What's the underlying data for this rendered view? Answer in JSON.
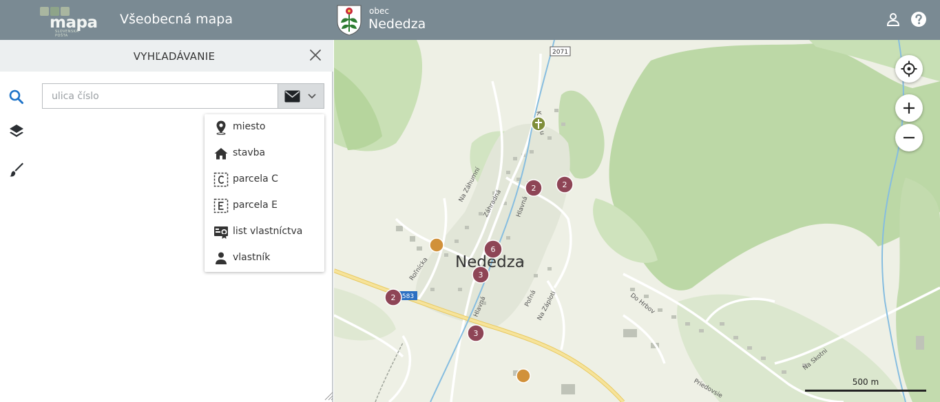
{
  "header": {
    "logo_text": "mapa",
    "logo_subtext": "SLOVENSKÁ POŠTA",
    "app_title": "Všeobecná mapa",
    "municipality_label": "obec",
    "municipality_name": "Nededza",
    "icons": [
      "user-icon",
      "help-icon"
    ]
  },
  "sidebar": {
    "tools": [
      {
        "icon": "search-icon",
        "active": true
      },
      {
        "icon": "layers-icon",
        "active": false
      },
      {
        "icon": "brush-icon",
        "active": false
      }
    ]
  },
  "panel": {
    "title": "VYHĽADÁVANIE",
    "search": {
      "placeholder": "ulica číslo",
      "value": ""
    },
    "type_selector_icon": "envelope-icon"
  },
  "dropdown": {
    "items": [
      {
        "label": "miesto",
        "icon": "location-pin-icon"
      },
      {
        "label": "stavba",
        "icon": "house-icon"
      },
      {
        "label": "parcela C",
        "icon": "parcel-c-icon"
      },
      {
        "label": "parcela E",
        "icon": "parcel-e-icon"
      },
      {
        "label": "list vlastníctva",
        "icon": "ownership-sheet-icon"
      },
      {
        "label": "vlastník",
        "icon": "person-icon"
      }
    ]
  },
  "map": {
    "town_label": "Nededza",
    "streets": [
      "Na Záhumní",
      "Záhradná",
      "Hlavná",
      "Roľnícka",
      "Hlavná",
      "Poľná",
      "Na Záploti",
      "Do Hrbov",
      "Na Skotni",
      "Priedovsie",
      "K Hájnu"
    ],
    "road_numbers": [
      "2071",
      "583"
    ],
    "clusters": [
      "2",
      "2",
      "6",
      "3",
      "2",
      "3"
    ],
    "scale_label": "500 m",
    "colors": {
      "cluster": "#8e4556",
      "poi": "#d1913a",
      "forest": "#b9d6a2",
      "road_major": "#f1d67a",
      "water": "#7ab6dd"
    }
  }
}
